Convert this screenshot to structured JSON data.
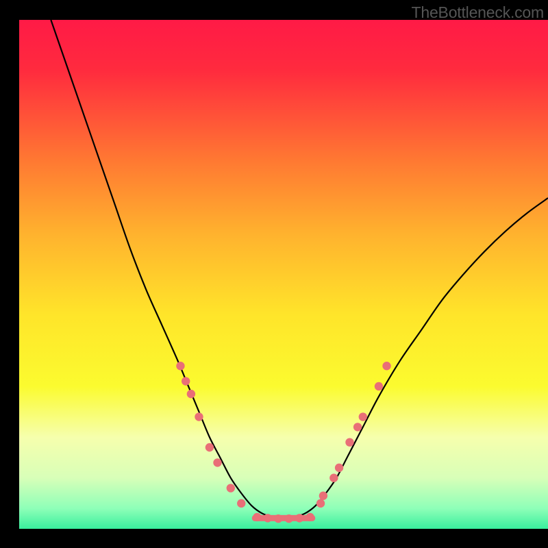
{
  "watermark": "TheBottleneck.com",
  "chart_data": {
    "type": "line",
    "title": "",
    "xlabel": "",
    "ylabel": "",
    "xlim": [
      0,
      100
    ],
    "ylim": [
      0,
      100
    ],
    "grid": false,
    "gradient_stops": [
      {
        "offset": 0.0,
        "color": "#ff1a46"
      },
      {
        "offset": 0.1,
        "color": "#ff2b3e"
      },
      {
        "offset": 0.28,
        "color": "#ff7a32"
      },
      {
        "offset": 0.42,
        "color": "#ffb22e"
      },
      {
        "offset": 0.58,
        "color": "#ffe52a"
      },
      {
        "offset": 0.72,
        "color": "#fbfb2f"
      },
      {
        "offset": 0.82,
        "color": "#f6ffad"
      },
      {
        "offset": 0.9,
        "color": "#d8ffb8"
      },
      {
        "offset": 0.96,
        "color": "#8effb8"
      },
      {
        "offset": 1.0,
        "color": "#39ef9d"
      }
    ],
    "series": [
      {
        "name": "bottleneck-curve",
        "x": [
          6,
          9,
          12,
          15,
          18,
          21,
          24,
          27,
          30,
          32,
          34,
          36,
          38,
          40,
          42,
          44,
          46,
          48,
          50,
          52,
          54,
          56,
          58,
          60,
          62,
          65,
          68,
          72,
          76,
          80,
          84,
          88,
          92,
          96,
          100
        ],
        "y": [
          100,
          91,
          82,
          73,
          64,
          55,
          47,
          40,
          33,
          28,
          23,
          18,
          14,
          10,
          7,
          4.5,
          3,
          2.3,
          2,
          2.3,
          3,
          4.5,
          7,
          10,
          14,
          20,
          26,
          33,
          39,
          45,
          50,
          54.5,
          58.5,
          62,
          65
        ]
      }
    ],
    "markers": {
      "name": "highlighted-points",
      "color": "#e96f77",
      "points": [
        {
          "x": 30.5,
          "y": 32
        },
        {
          "x": 31.5,
          "y": 29
        },
        {
          "x": 32.5,
          "y": 26.5
        },
        {
          "x": 34.0,
          "y": 22
        },
        {
          "x": 36.0,
          "y": 16
        },
        {
          "x": 37.5,
          "y": 13
        },
        {
          "x": 40.0,
          "y": 8
        },
        {
          "x": 42.0,
          "y": 5
        },
        {
          "x": 45.0,
          "y": 2.3
        },
        {
          "x": 47.0,
          "y": 2.1
        },
        {
          "x": 49.0,
          "y": 2.0
        },
        {
          "x": 51.0,
          "y": 2.0
        },
        {
          "x": 53.0,
          "y": 2.1
        },
        {
          "x": 55.0,
          "y": 2.3
        },
        {
          "x": 57.0,
          "y": 5
        },
        {
          "x": 57.5,
          "y": 6.5
        },
        {
          "x": 59.5,
          "y": 10
        },
        {
          "x": 60.5,
          "y": 12
        },
        {
          "x": 62.5,
          "y": 17
        },
        {
          "x": 64.0,
          "y": 20
        },
        {
          "x": 65.0,
          "y": 22
        },
        {
          "x": 68.0,
          "y": 28
        },
        {
          "x": 69.5,
          "y": 32
        }
      ]
    },
    "flat_segment": {
      "x1": 44,
      "x2": 56,
      "y": 2.1
    }
  }
}
